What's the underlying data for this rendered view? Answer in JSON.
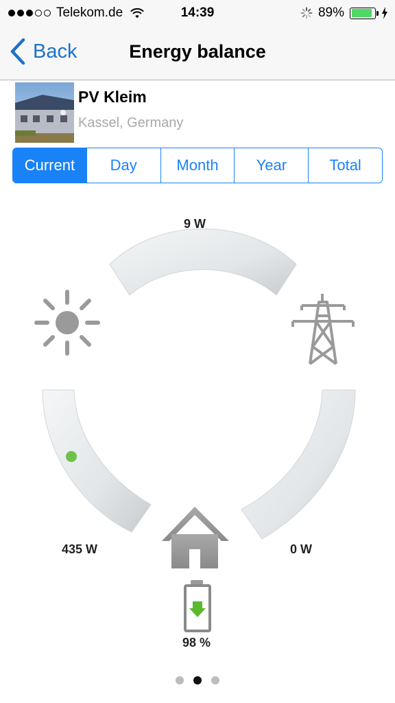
{
  "status_bar": {
    "carrier": "Telekom.de",
    "signal_bars_on": 3,
    "signal_bars_total": 5,
    "time": "14:39",
    "battery": "89%",
    "battery_level": 0.89
  },
  "nav": {
    "back_label": "Back",
    "title": "Energy balance"
  },
  "plant": {
    "name": "PV Kleim",
    "location": "Kassel, Germany"
  },
  "tabs": [
    {
      "label": "Current",
      "active": true
    },
    {
      "label": "Day",
      "active": false
    },
    {
      "label": "Month",
      "active": false
    },
    {
      "label": "Year",
      "active": false
    },
    {
      "label": "Total",
      "active": false
    }
  ],
  "balance": {
    "grid_to_consumption": "9 W",
    "pv_power": "435 W",
    "battery_power": "0 W",
    "battery_soc": "98 %",
    "battery_state": "charging"
  },
  "colors": {
    "accent": "#1a82f7",
    "back": "#1a72c9",
    "flow_dot": "#6cc24a",
    "battery_arrow": "#5cb82e",
    "icon_gray": "#9a9a9a"
  },
  "pager": {
    "count": 3,
    "active_index": 1
  }
}
